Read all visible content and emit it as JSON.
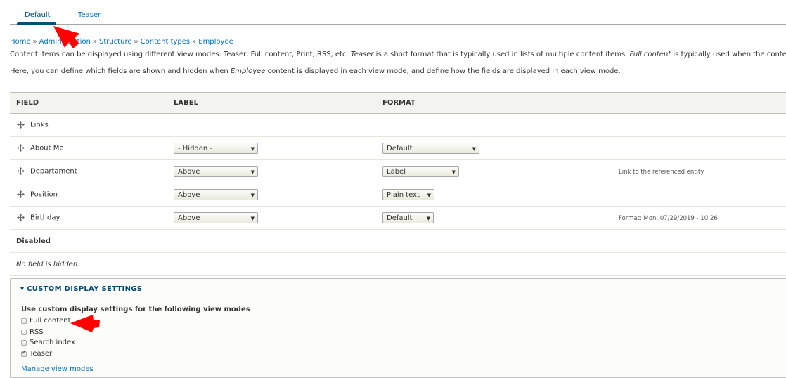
{
  "tabs": [
    {
      "label": "Default",
      "active": true
    },
    {
      "label": "Teaser",
      "active": false
    }
  ],
  "breadcrumb": [
    "Home",
    "Administration",
    "Structure",
    "Content types",
    "Employee"
  ],
  "breadcrumb_separator": "»",
  "description": {
    "line1_a": "Content items can be displayed using different view modes: Teaser, Full content, Print, RSS, etc. ",
    "line1_em1": "Teaser",
    "line1_b": " is a short format that is typically used in lists of multiple content items. ",
    "line1_em2": "Full content",
    "line1_c": " is typically used when the content is displayed on its own page.",
    "line2_a": "Here, you can define which fields are shown and hidden when ",
    "line2_em": "Employee",
    "line2_b": " content is displayed in each view mode, and define how the fields are displayed in each view mode."
  },
  "table": {
    "headers": [
      "Field",
      "Label",
      "Format",
      ""
    ],
    "rows": [
      {
        "field": "Links",
        "label": "",
        "format": "",
        "summary": ""
      },
      {
        "field": "About Me",
        "label": "- Hidden -",
        "format": "Default",
        "summary": ""
      },
      {
        "field": "Departament",
        "label": "Above",
        "format": "Label",
        "summary": "Link to the referenced entity"
      },
      {
        "field": "Position",
        "label": "Above",
        "format": "Plain text",
        "summary": ""
      },
      {
        "field": "Birthday",
        "label": "Above",
        "format": "Default",
        "summary": "Format: Mon, 07/29/2019 - 10:26"
      }
    ],
    "disabled_label": "Disabled",
    "empty_message": "No field is hidden."
  },
  "custom_display": {
    "summary": "▾ CUSTOM DISPLAY SETTINGS",
    "title": "Use custom display settings for the following view modes",
    "options": [
      {
        "label": "Full content",
        "checked": false
      },
      {
        "label": "RSS",
        "checked": false
      },
      {
        "label": "Search index",
        "checked": false
      },
      {
        "label": "Teaser",
        "checked": true
      }
    ],
    "manage_link": "Manage view modes"
  },
  "colors": {
    "link": "#0074bd",
    "active_tab": "#004f80",
    "annotation_arrow": "#ff0000",
    "header_bg": "#f3f3ef"
  }
}
